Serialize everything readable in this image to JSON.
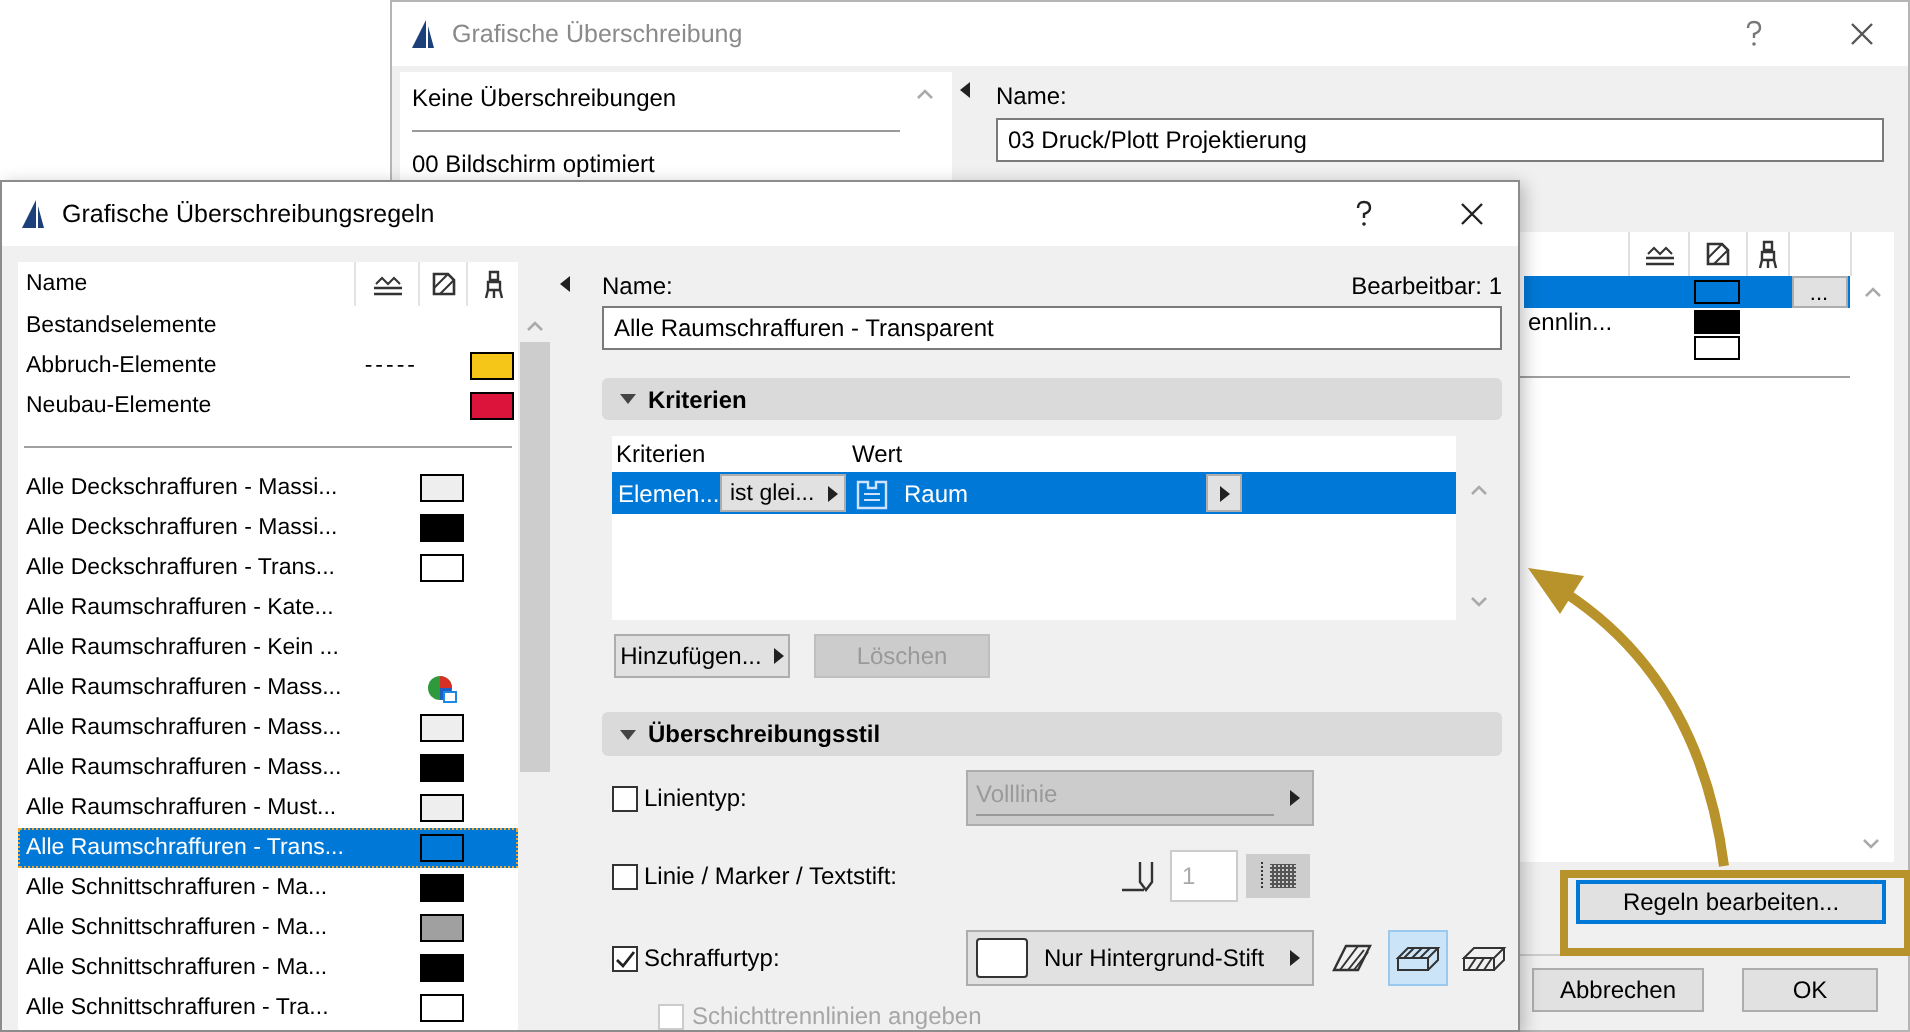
{
  "back_window": {
    "title": "Grafische Überschreibung",
    "list_items": [
      "Keine Überschreibungen",
      "00 Bildschirm optimiert"
    ],
    "name_label": "Name:",
    "name_value": "03 Druck/Plott Projektierung",
    "rules": [
      {
        "selected": true,
        "color": "#0078d7",
        "action": "..."
      },
      {
        "selected": false,
        "label": "ennlin...",
        "color": "#000000"
      },
      {
        "selected": false,
        "color": "#ffffff"
      }
    ],
    "edit_rules_button": "Regeln bearbeiten...",
    "buttons": [
      "Abbrechen",
      "OK"
    ]
  },
  "rules_window": {
    "title": "Grafische Überschreibungsregeln",
    "list_header": "Name",
    "phase_rules": [
      {
        "label": "Bestandselemente",
        "kind": "plain",
        "selected": false
      },
      {
        "label": "Abbruch-Elemente",
        "kind": "pen",
        "line": "-----",
        "color": "#f5c518",
        "selected": false
      },
      {
        "label": "Neubau-Elemente",
        "kind": "pen",
        "color": "#dc143c",
        "selected": false
      }
    ],
    "rules": [
      {
        "label": "Alle Deckschraffuren - Massi...",
        "kind": "fill",
        "color": "#eeeeee",
        "selected": false
      },
      {
        "label": "Alle Deckschraffuren - Massi...",
        "kind": "fill",
        "color": "#000000",
        "selected": false
      },
      {
        "label": "Alle Deckschraffuren - Trans...",
        "kind": "fill",
        "color": "#ffffff",
        "selected": false
      },
      {
        "label": "Alle Raumschraffuren - Kate...",
        "kind": "plain",
        "selected": false
      },
      {
        "label": "Alle Raumschraffuren - Kein ...",
        "kind": "plain",
        "selected": false
      },
      {
        "label": "Alle Raumschraffuren - Mass...",
        "kind": "fill_icon",
        "selected": false
      },
      {
        "label": "Alle Raumschraffuren - Mass...",
        "kind": "fill",
        "color": "#eeeeee",
        "selected": false
      },
      {
        "label": "Alle Raumschraffuren - Mass...",
        "kind": "fill",
        "color": "#000000",
        "selected": false
      },
      {
        "label": "Alle Raumschraffuren - Must...",
        "kind": "fill",
        "color": "#eeeeee",
        "selected": false
      },
      {
        "label": "Alle Raumschraffuren - Trans...",
        "kind": "fill",
        "color": "#0078d7",
        "selected": true
      },
      {
        "label": "Alle Schnittschraffuren - Ma...",
        "kind": "fill",
        "color": "#000000",
        "selected": false
      },
      {
        "label": "Alle Schnittschraffuren - Ma...",
        "kind": "fill",
        "color": "#a0a0a0",
        "selected": false
      },
      {
        "label": "Alle Schnittschraffuren - Ma...",
        "kind": "fill",
        "color": "#000000",
        "selected": false
      },
      {
        "label": "Alle Schnittschraffuren - Tra...",
        "kind": "fill",
        "color": "#ffffff",
        "selected": false
      }
    ],
    "editor": {
      "name_label": "Name:",
      "editable": "Bearbeitbar: 1",
      "name_value": "Alle Raumschraffuren - Transparent",
      "criteria": {
        "title": "Kriterien",
        "expanded": true,
        "columns": [
          "Kriterien",
          "Wert"
        ],
        "rows": [
          {
            "criterion": "Elemen...",
            "operator": "ist glei...",
            "value": "Raum",
            "selected": true
          }
        ],
        "buttons": [
          {
            "label": "Hinzufügen...",
            "kind": "menu",
            "disabled": false
          },
          {
            "label": "Löschen",
            "kind": "plain",
            "disabled": true
          }
        ]
      },
      "style": {
        "title": "Überschreibungsstil",
        "expanded": true,
        "rows": [
          {
            "kind": "line_type",
            "label": "Linientyp:",
            "checked": false,
            "value": "Volllinie"
          },
          {
            "kind": "pen",
            "label": "Linie / Marker / Textstift:",
            "checked": false,
            "value": "1"
          },
          {
            "kind": "fill",
            "label": "Schraffurtyp:",
            "checked": true,
            "value": "Nur Hintergrund-Stift",
            "modes": [
              {
                "kind": "hatch",
                "selected": false
              },
              {
                "kind": "top",
                "selected": true
              },
              {
                "kind": "side",
                "selected": false
              }
            ]
          }
        ],
        "sub_option": {
          "label": "Schichttrennlinien angeben",
          "checked": false,
          "disabled": true
        }
      }
    }
  }
}
